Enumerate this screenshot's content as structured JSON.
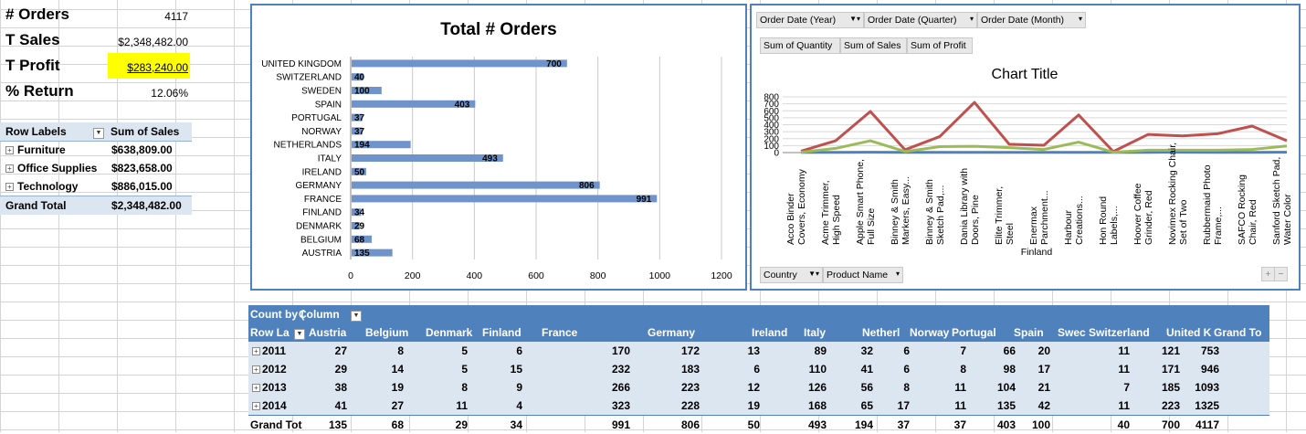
{
  "kpis": [
    {
      "label": "# Orders",
      "value": "4117",
      "highlight": false
    },
    {
      "label": "T Sales",
      "value": "$2,348,482.00",
      "highlight": false
    },
    {
      "label": "T Profit",
      "value": "$283,240.00",
      "highlight": true
    },
    {
      "label": "% Return",
      "value": "12.06%",
      "highlight": false
    }
  ],
  "category_pivot": {
    "headers": [
      "Row Labels",
      "Sum of Sales"
    ],
    "rows": [
      {
        "label": "Furniture",
        "value": "$638,809.00"
      },
      {
        "label": "Office Supplies",
        "value": "$823,658.00"
      },
      {
        "label": "Technology",
        "value": "$886,015.00"
      }
    ],
    "total": {
      "label": "Grand Total",
      "value": "$2,348,482.00"
    }
  },
  "chart_data": [
    {
      "type": "bar",
      "title": "Total # Orders",
      "categories": [
        "UNITED KINGDOM",
        "SWITZERLAND",
        "SWEDEN",
        "SPAIN",
        "PORTUGAL",
        "NORWAY",
        "NETHERLANDS",
        "ITALY",
        "IRELAND",
        "GERMANY",
        "FRANCE",
        "FINLAND",
        "DENMARK",
        "BELGIUM",
        "AUSTRIA"
      ],
      "values": [
        700,
        40,
        100,
        403,
        37,
        37,
        194,
        493,
        50,
        806,
        991,
        34,
        29,
        68,
        135
      ],
      "xlim": [
        0,
        1200
      ],
      "xticks": [
        "0",
        "200",
        "400",
        "600",
        "800",
        "1000",
        "1200"
      ],
      "grid": true,
      "color": "#6f94cb"
    },
    {
      "type": "line",
      "title": "Chart Title",
      "xlabel": "Finland",
      "categories": [
        "Acco Binder Covers, Economy",
        "Acme Trimmer, High Speed",
        "Apple Smart Phone, Full Size",
        "Binney & Smith Markers, Easy...",
        "Binney & Smith Sketch Pad,...",
        "Dania Library with Doors, Pine",
        "Elite Trimmer, Steel",
        "Enermax Parchment...",
        "Harbour Creations...",
        "Hon Round Labels,...",
        "Hoover Coffee Grinder, Red",
        "Novimex Rocking Chair, Set of Two",
        "Rubbermaid Photo Frame,...",
        "SAFCO Rocking Chair, Red",
        "Sanford Sketch Pad, Water Color"
      ],
      "ylim": [
        0,
        800
      ],
      "yticks": [
        "0",
        "100",
        "200",
        "300",
        "400",
        "500",
        "600",
        "700",
        "800"
      ],
      "series": [
        {
          "name": "Sum of Quantity",
          "color": "#4f81bd",
          "values": [
            3,
            4,
            5,
            3,
            4,
            4,
            3,
            3,
            4,
            3,
            4,
            5,
            4,
            4,
            5
          ]
        },
        {
          "name": "Sum of Sales",
          "color": "#c0504d",
          "values": [
            20,
            170,
            590,
            40,
            230,
            720,
            120,
            105,
            540,
            15,
            260,
            240,
            270,
            380,
            170
          ]
        },
        {
          "name": "Sum of Profit",
          "color": "#9bbb59",
          "values": [
            5,
            60,
            170,
            15,
            85,
            90,
            70,
            45,
            150,
            5,
            35,
            35,
            35,
            45,
            95
          ]
        }
      ],
      "filter_buttons": [
        "Order Date (Year)",
        "Order Date (Quarter)",
        "Order Date (Month)"
      ],
      "value_buttons": [
        "Sum of Quantity",
        "Sum of Sales",
        "Sum of Profit"
      ],
      "axis_buttons": [
        "Country",
        "Product Name"
      ]
    }
  ],
  "year_pivot": {
    "corner": "Count by (",
    "column_labels": "Column",
    "row_labels": "Row La",
    "countries": [
      "Austria",
      "Belgium",
      "Denmark",
      "Finland",
      "France",
      "Germany",
      "Ireland",
      "Italy",
      "Netherl",
      "Norway",
      "Portugal",
      "Spain",
      "Swec",
      "Switzerland",
      "United K",
      "Grand To"
    ],
    "rows": [
      {
        "label": "2011",
        "values": [
          "27",
          "8",
          "5",
          "6",
          "170",
          "172",
          "13",
          "89",
          "32",
          "6",
          "7",
          "66",
          "20",
          "11",
          "121",
          "753"
        ]
      },
      {
        "label": "2012",
        "values": [
          "29",
          "14",
          "5",
          "15",
          "232",
          "183",
          "6",
          "110",
          "41",
          "6",
          "8",
          "98",
          "17",
          "11",
          "171",
          "946"
        ]
      },
      {
        "label": "2013",
        "values": [
          "38",
          "19",
          "8",
          "9",
          "266",
          "223",
          "12",
          "126",
          "56",
          "8",
          "11",
          "104",
          "21",
          "7",
          "185",
          "1093"
        ]
      },
      {
        "label": "2014",
        "values": [
          "41",
          "27",
          "11",
          "4",
          "323",
          "228",
          "19",
          "168",
          "65",
          "17",
          "11",
          "135",
          "42",
          "11",
          "223",
          "1325"
        ]
      }
    ],
    "total": {
      "label": "Grand Tot",
      "values": [
        "135",
        "68",
        "29",
        "34",
        "991",
        "806",
        "50",
        "493",
        "194",
        "37",
        "37",
        "403",
        "100",
        "40",
        "700",
        "4117"
      ]
    }
  }
}
